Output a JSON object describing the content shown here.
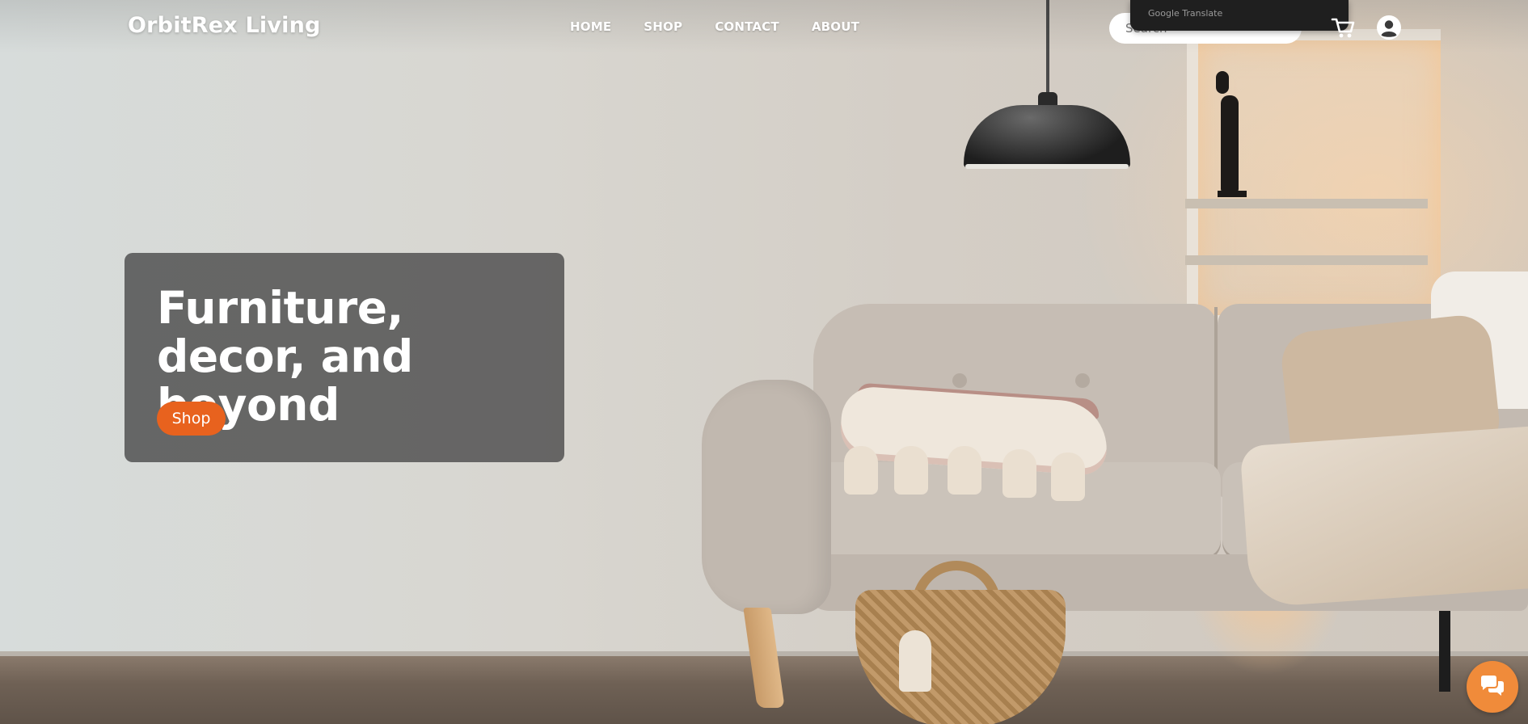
{
  "header": {
    "logo": "OrbitRex Living",
    "nav": [
      {
        "label": "HOME"
      },
      {
        "label": "SHOP"
      },
      {
        "label": "CONTACT"
      },
      {
        "label": "ABOUT"
      }
    ],
    "search": {
      "placeholder": "Search",
      "value": ""
    },
    "translate_label": "Google Translate",
    "icons": {
      "cart": "cart-icon",
      "account": "user-account-icon"
    }
  },
  "hero": {
    "title": "Furniture, decor, and beyond",
    "button_label": "Shop"
  },
  "chat": {
    "icon": "chat-bubbles-icon"
  },
  "colors": {
    "accent": "#e8621e",
    "chat": "#f08b3a",
    "hero_card": "#555555",
    "text_light": "#ffffff"
  }
}
